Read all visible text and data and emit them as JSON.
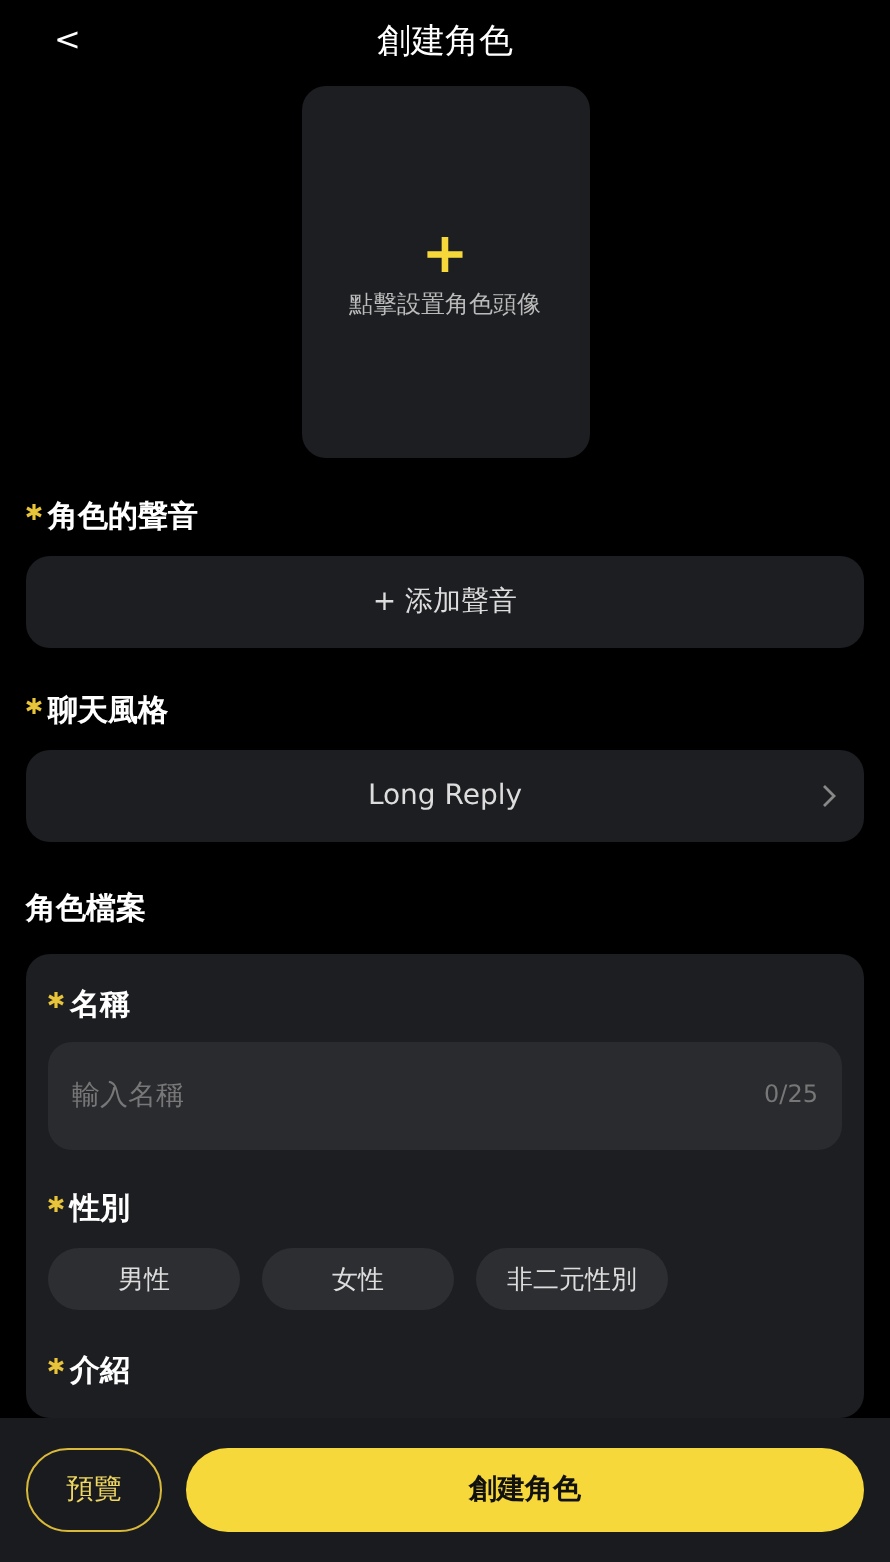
{
  "header": {
    "back": "<",
    "title": "創建角色"
  },
  "avatar": {
    "plus": "+",
    "hint": "點擊設置角色頭像"
  },
  "voice": {
    "label": "角色的聲音",
    "required": true,
    "button": "+ 添加聲音"
  },
  "chat_style": {
    "label": "聊天風格",
    "required": true,
    "value": "Long Reply"
  },
  "profile": {
    "title": "角色檔案",
    "name": {
      "label": "名稱",
      "required": true,
      "placeholder": "輸入名稱",
      "counter": "0/25"
    },
    "gender": {
      "label": "性別",
      "required": true,
      "options": [
        {
          "label": "男性",
          "selected": false
        },
        {
          "label": "女性",
          "selected": false
        },
        {
          "label": "非二元性別",
          "selected": false
        }
      ]
    },
    "intro": {
      "label": "介紹",
      "required": true
    }
  },
  "footer": {
    "preview": "預覽",
    "create": "創建角色"
  }
}
